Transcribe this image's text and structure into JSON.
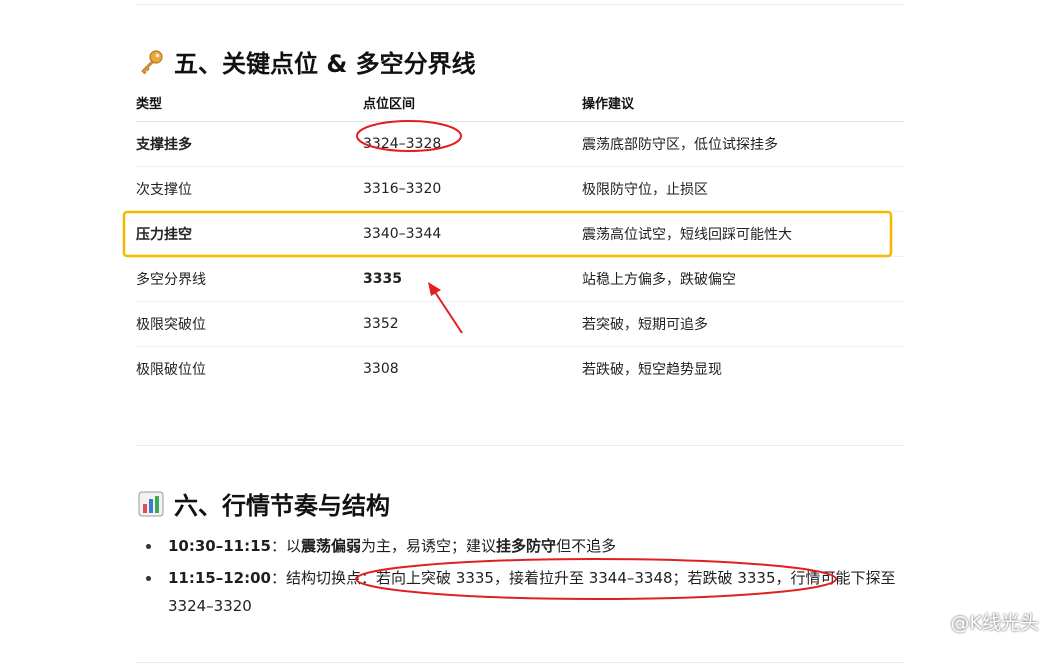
{
  "section5": {
    "icon": "key-icon",
    "title": "五、关键点位 & 多空分界线"
  },
  "table": {
    "headers": [
      "类型",
      "点位区间",
      "操作建议"
    ],
    "rows": [
      {
        "type": "支撑挂多",
        "range": "3324–3328",
        "advice": "震荡底部防守区，低位试探挂多"
      },
      {
        "type": "次支撑位",
        "range": "3316–3320",
        "advice": "极限防守位，止损区"
      },
      {
        "type": "压力挂空",
        "range": "3340–3344",
        "advice": "震荡高位试空，短线回踩可能性大"
      },
      {
        "type": "多空分界线",
        "range": "3335",
        "advice": "站稳上方偏多，跌破偏空"
      },
      {
        "type": "极限突破位",
        "range": "3352",
        "advice": "若突破，短期可追多"
      },
      {
        "type": "极限破位位",
        "range": "3308",
        "advice": "若跌破，短空趋势显现"
      }
    ]
  },
  "section6": {
    "icon": "bar-chart-icon",
    "title": "六、行情节奏与结构"
  },
  "bullets": [
    {
      "time": "10:30–11:15",
      "p1": "：以",
      "b1": "震荡偏弱",
      "p2": "为主，易诱空；建议",
      "b2": "挂多防守",
      "p3": "但不追多"
    },
    {
      "time": "11:15–12:00",
      "text": "：结构切换点：若向上突破 3335，接着拉升至 3344–3348；若跌破 3335，行情可能下探至 3324–3320"
    }
  ],
  "watermark": {
    "text": "@K线光头"
  },
  "colors": {
    "highlight_box": "#f5b800",
    "annotation_red": "#e02020"
  }
}
